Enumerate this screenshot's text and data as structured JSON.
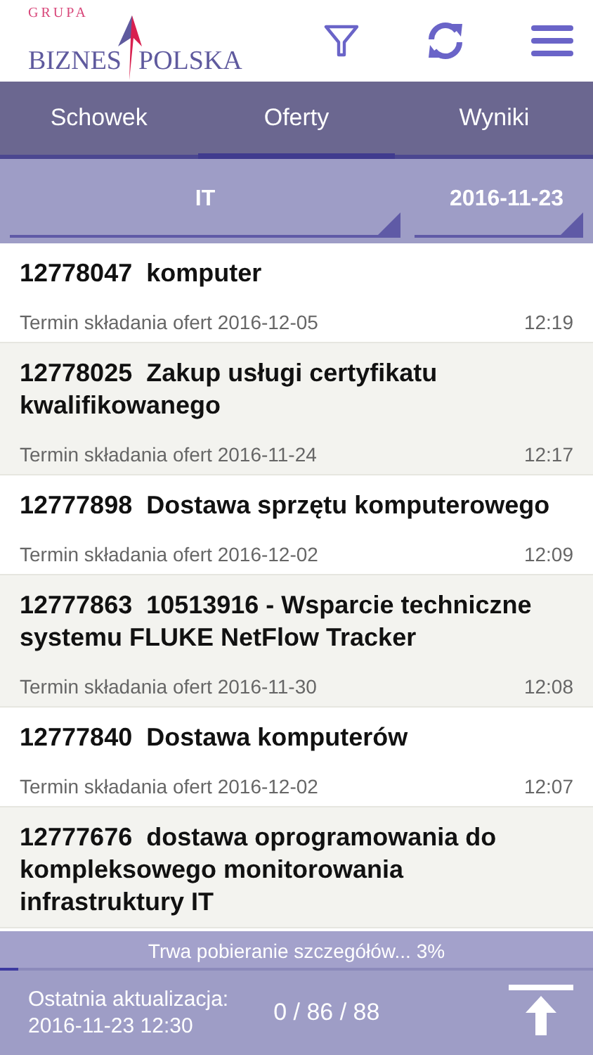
{
  "logo": {
    "top": "GRUPA",
    "left": "BIZNES",
    "right": "POLSKA"
  },
  "tabs": [
    {
      "label": "Schowek",
      "selected": false
    },
    {
      "label": "Oferty",
      "selected": true
    },
    {
      "label": "Wyniki",
      "selected": false
    }
  ],
  "filters": [
    {
      "value": "IT"
    },
    {
      "value": "2016-11-23"
    }
  ],
  "offers": [
    {
      "title": "12778047  komputer",
      "deadline": "Termin składania ofert 2016-12-05",
      "time": "12:19"
    },
    {
      "title": "12778025  Zakup usługi certyfikatu kwalifikowanego",
      "deadline": "Termin składania ofert 2016-11-24",
      "time": "12:17"
    },
    {
      "title": "12777898  Dostawa sprzętu komputerowego",
      "deadline": "Termin składania ofert 2016-12-02",
      "time": "12:09"
    },
    {
      "title": "12777863  10513916 - Wsparcie techniczne systemu FLUKE NetFlow Tracker",
      "deadline": "Termin składania ofert 2016-11-30",
      "time": "12:08"
    },
    {
      "title": "12777840  Dostawa komputerów",
      "deadline": "Termin składania ofert 2016-12-02",
      "time": "12:07"
    },
    {
      "title": "12777676  dostawa oprogramowania do kompleksowego monitorowania infrastruktury IT"
    }
  ],
  "download": {
    "text": "Trwa pobieranie szczegółów... 3%",
    "level": 0.03
  },
  "footer": {
    "updated_label": "Ostatnia aktualizacja:",
    "updated_value": "2016-11-23 12:30",
    "counts": "0 / 86 / 88"
  }
}
